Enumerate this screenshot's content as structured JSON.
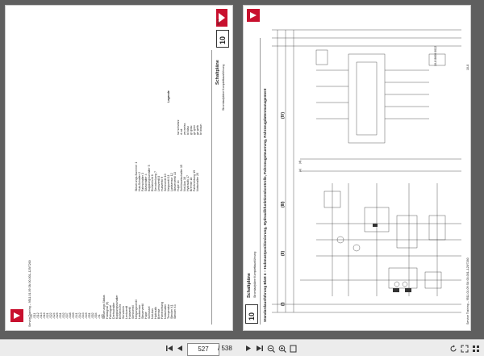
{
  "viewer": {
    "page_current": "527",
    "page_separator": "/",
    "page_total": "538"
  },
  "left_page": {
    "chapter_number": "10",
    "chapter_title": "Schaltpläne",
    "chapter_subtitle": "Stromlaufpläne Komplettausführung",
    "footer_text": "Service Training – 9511.01.09 SN 00-001–129/7260",
    "page_number": "10-7",
    "col1": [
      "-S5",
      "-S11",
      "-S12",
      "-S13",
      "-S16",
      "-S21",
      "-S22",
      "-S24",
      "-S25",
      "-S31",
      "-S32",
      "-S37",
      "-S38",
      "-S39",
      "-S41",
      "-S42",
      "-S43",
      "-S45",
      "-S51",
      "-S52",
      "-S54",
      "-X1",
      "-X3"
    ],
    "col2": [
      "Steuerungs Status",
      "Hubsignal (9)",
      "Fahrsignal",
      "Drehschalter",
      "Kupplungsschalter",
      "Einfahrlicht",
      "Servolenk",
      "Lenkventil",
      "Hubventil",
      "Senkventil",
      "Neigungsventil",
      "Lastsensor",
      "Steuerventil",
      "Hupe",
      "Schlüssel",
      "Not-Aus",
      "Hydraulik",
      "Bremse",
      "Fahrtrichtung",
      "Notschalter",
      "Temperatur",
      "Stecker X1",
      "Stecker X3"
    ],
    "col3": [
      "Steuerungs-Nummer 1",
      "Hub-Schalter 2",
      "Fahrschalter 3",
      "Sitzschalter 4",
      "Kupplungsschalter 5",
      "Einfahrlicht 6",
      "Servolenkung 7",
      "Lenkventil 8",
      "Hubventil 9",
      "Senkventil 10",
      "Neigventil 11",
      "Lastsensor 12",
      "Steuerventil 13",
      "Hupe 14",
      "Schlüsselschalter 15",
      "Not-Aus 16",
      "Hydraulik 17",
      "Bremse 18",
      "Fahrtrichtung 19",
      "Notschalter 20"
    ],
    "legend_title": "Legende",
    "legend_items": [
      "sw schwarz",
      "rt rot",
      "ws weiss",
      "bl blau",
      "gr grau",
      "gn grün",
      "ge gelb",
      "br braun"
    ]
  },
  "right_page": {
    "chapter_number": "10",
    "chapter_title": "Schaltpläne",
    "chapter_subtitle": "Stromlaufpläne Komplettausführung",
    "diagram_title": "Standardausführung Blatt 4 – Hubmastpositionierung, Hydraulikfunktionskontrolle, Fahrzeugsteuerung, Fahrzeugdatenmanagement",
    "page_number": "10-8",
    "footer_text": "Service Training – 9511.01.09 SN 00-001–129/7260",
    "doc_code": "10-8 8600 0022",
    "roman_labels": [
      "(I)",
      "(II)",
      "(III)",
      "(IV)"
    ],
    "section_labels": [
      "(c)",
      "(d)"
    ]
  },
  "icons": {
    "first": "first-page-icon",
    "prev": "previous-page-icon",
    "next": "next-page-icon",
    "last": "last-page-icon",
    "zoom_out": "zoom-out-icon",
    "zoom_in": "zoom-in-icon",
    "fit": "fit-page-icon",
    "fullscreen": "fullscreen-icon",
    "rotate": "rotate-icon",
    "grid": "grid-view-icon"
  },
  "colors": {
    "brand_red": "#c8102e",
    "toolbar_bg": "#ececec",
    "viewer_bg": "#5f5f5f"
  }
}
